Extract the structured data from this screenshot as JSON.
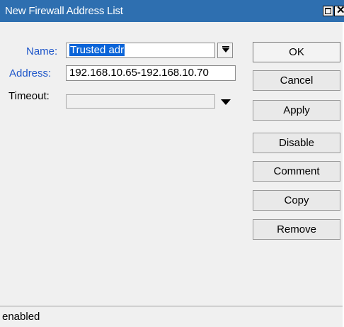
{
  "window": {
    "title": "New Firewall Address List",
    "maximize_icon": "maximize-icon",
    "close_icon": "close-icon",
    "close_glyph": "✕"
  },
  "form": {
    "name_label": "Name:",
    "name_value": "Trusted adr",
    "address_label": "Address:",
    "address_value": "192.168.10.65-192.168.10.70",
    "timeout_label": "Timeout:",
    "timeout_value": ""
  },
  "buttons": {
    "ok": "OK",
    "cancel": "Cancel",
    "apply": "Apply",
    "disable": "Disable",
    "comment": "Comment",
    "copy": "Copy",
    "remove": "Remove"
  },
  "status": {
    "text": "enabled"
  },
  "colors": {
    "titlebar": "#2e6fb0",
    "label_blue": "#1d55c9",
    "selection": "#0a64d8"
  }
}
